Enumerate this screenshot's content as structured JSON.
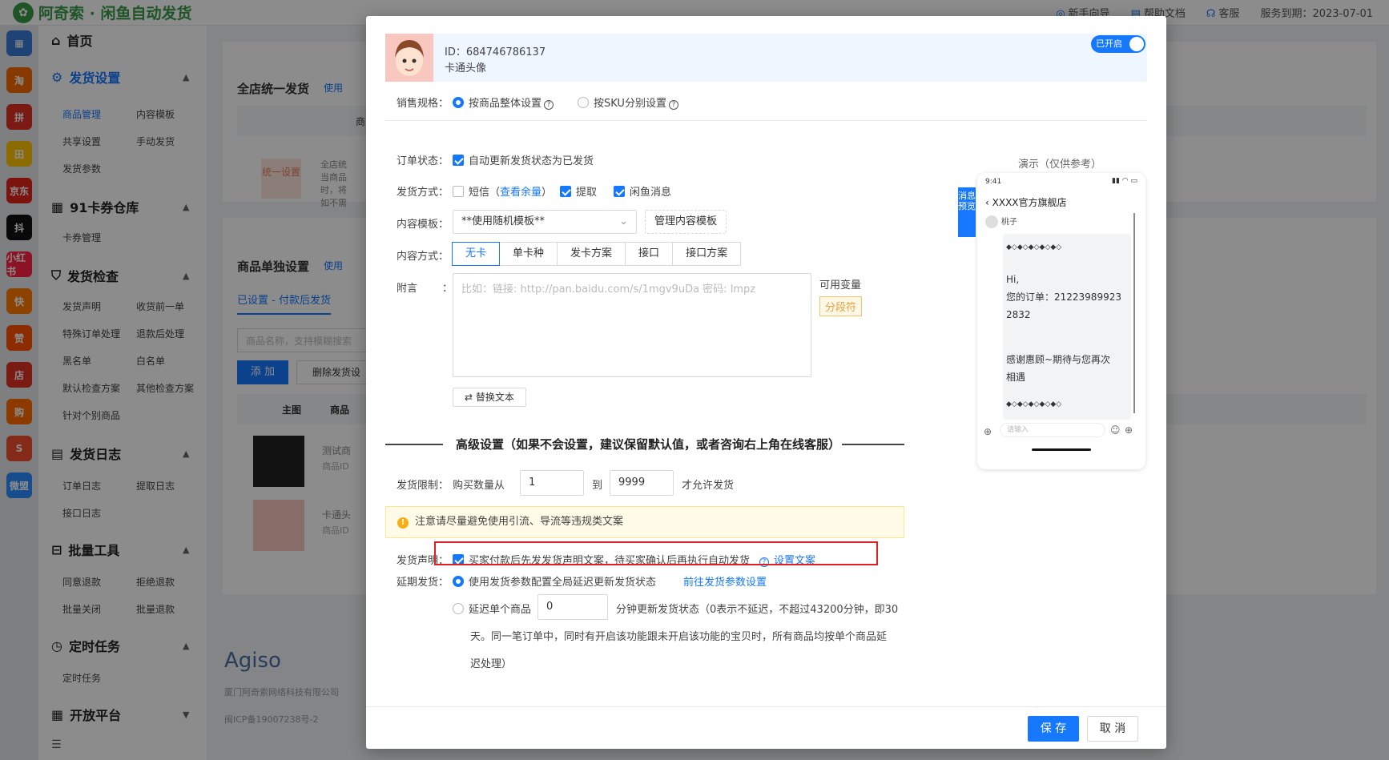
{
  "app": {
    "title": "阿奇索 · 闲鱼自动发货"
  },
  "top_links": [
    {
      "label": "新手向导",
      "icon": "guide-icon"
    },
    {
      "label": "帮助文档",
      "icon": "doc-icon"
    },
    {
      "label": "客服",
      "icon": "headset-icon"
    },
    {
      "label": "服务到期：2023-07-01",
      "icon": ""
    }
  ],
  "strip_icons": [
    {
      "label": "淘",
      "color": "#f56a00"
    },
    {
      "label": "拼",
      "color": "#e02e24"
    },
    {
      "label": "田",
      "color": "#ffc300"
    },
    {
      "label": "京东",
      "color": "#e1251b"
    },
    {
      "label": "抖",
      "color": "#111111"
    },
    {
      "label": "小红书",
      "color": "#ff2442"
    },
    {
      "label": "快",
      "color": "#ff7a00"
    },
    {
      "label": "赞",
      "color": "#ff5000"
    },
    {
      "label": "店",
      "color": "#e02e24"
    },
    {
      "label": "购",
      "color": "#ff6a00"
    },
    {
      "label": "S",
      "color": "#ee4d2d"
    },
    {
      "label": "微盟",
      "color": "#2b8cff"
    }
  ],
  "sidebar": {
    "home": "首页",
    "groups": [
      {
        "title": "发货设置",
        "items": [
          "商品管理",
          "内容模板",
          "共享设置",
          "手动发货",
          "发货参数"
        ]
      },
      {
        "title": "91卡券仓库",
        "items": [
          "卡券管理"
        ]
      },
      {
        "title": "发货检查",
        "items": [
          "发货声明",
          "收货前一单",
          "特殊订单处理",
          "退款后处理",
          "黑名单",
          "白名单",
          "默认检查方案",
          "其他检查方案",
          "针对个别商品"
        ]
      },
      {
        "title": "发货日志",
        "items": [
          "订单日志",
          "提取日志",
          "接口日志"
        ]
      },
      {
        "title": "批量工具",
        "items": [
          "同意退款",
          "拒绝退款",
          "批量关闭",
          "批量退款"
        ]
      },
      {
        "title": "定时任务",
        "items": [
          "定时任务"
        ]
      },
      {
        "title": "开放平台",
        "items": []
      }
    ]
  },
  "background": {
    "section1_title": "全店统一发货",
    "section1_link": "使用",
    "col_product": "商品",
    "unify_btn": "统一设置",
    "unify_desc": "全店统 当商品 时，将 如不需",
    "section2_title": "商品单独设置",
    "section2_link": "使用",
    "tab_set": "已设置 - 付款后发货",
    "search_placeholder": "商品名称，支持模糊搜索",
    "add_btn": "添 加",
    "delete_btn": "删除发货设",
    "col_main_image": "主图",
    "col_product2": "商品",
    "rows": [
      {
        "title": "测试商",
        "sub": "商品ID"
      },
      {
        "title": "卡通头",
        "sub": "商品ID"
      }
    ],
    "footer_brand": "Agiso",
    "footer_company": "厦门阿奇索网络科技有限公司",
    "footer_icp": "闽ICP备19007238号-2"
  },
  "modal": {
    "id_text": "ID：684746786137",
    "nickname": "卡通头像",
    "toggle": "已开启",
    "spec_label": "销售规格：",
    "spec_opt1": "按商品整体设置",
    "spec_opt2": "按SKU分别设置",
    "order_status_label": "订单状态：",
    "order_status_opt": "自动更新发货状态为已发货",
    "ship_method_label": "发货方式：",
    "ship_sms": "短信",
    "ship_sms_link": "查看余量",
    "ship_extract": "提取",
    "ship_xianyu": "闲鱼消息",
    "template_label": "内容模板：",
    "template_value": "**使用随机模板**",
    "manage_template_btn": "管理内容模板",
    "content_mode_label": "内容方式：",
    "content_modes": [
      "无卡",
      "单卡种",
      "发卡方案",
      "接口",
      "接口方案"
    ],
    "note_label": "附言",
    "note_colon": "：",
    "note_placeholder": "比如：链接: http://pan.baidu.com/s/1mgv9uDa 密码: lmpz",
    "vars_label": "可用变量",
    "var_tag": "分段符",
    "replace_btn": "替换文本",
    "advanced_title": "高级设置（如果不会设置，建议保留默认值，或者咨询右上角在线客服）",
    "limit_label": "发货限制：",
    "limit_from": "购买数量从",
    "limit_min": "1",
    "limit_to": "到",
    "limit_max": "9999",
    "limit_suffix": "才允许发货",
    "warning": "注意请尽量避免使用引流、导流等违规类文案",
    "declare_label": "发货声明：",
    "declare_opt": "买家付款后先发发货声明文案，待买家确认后再执行自动发货",
    "declare_link": "设置文案",
    "delay_label": "延期发货：",
    "delay_opt1": "使用发货参数配置全局延迟更新发货状态",
    "delay_opt1_link": "前往发货参数设置",
    "delay_opt2_prefix": "延迟单个商品",
    "delay_opt2_value": "0",
    "delay_opt2_line1": "分钟更新发货状态（0表示不延迟，不超过43200分钟，即30",
    "delay_opt2_line2": "天。同一笔订单中，同时有开启该功能跟未开启该功能的宝贝时，所有商品均按单个商品延",
    "delay_opt2_line3": "迟处理）",
    "save_btn": "保 存",
    "cancel_btn": "取 消",
    "preview_title": "演示（仅供参考）",
    "preview_tab": "消息预览",
    "phone": {
      "time": "9:41",
      "shop": "XXXX官方旗舰店",
      "user": "桃子",
      "msg_lines": [
        "◆◇◆◇◆◇◆◇◆◇",
        "",
        "Hi,",
        "您的订单：21223989923",
        "2832",
        "",
        "",
        "感谢惠顾~期待与您再次",
        "相遇",
        "",
        "◆◇◆◇◆◇◆◇◆◇"
      ],
      "input_placeholder": "请输入"
    }
  }
}
